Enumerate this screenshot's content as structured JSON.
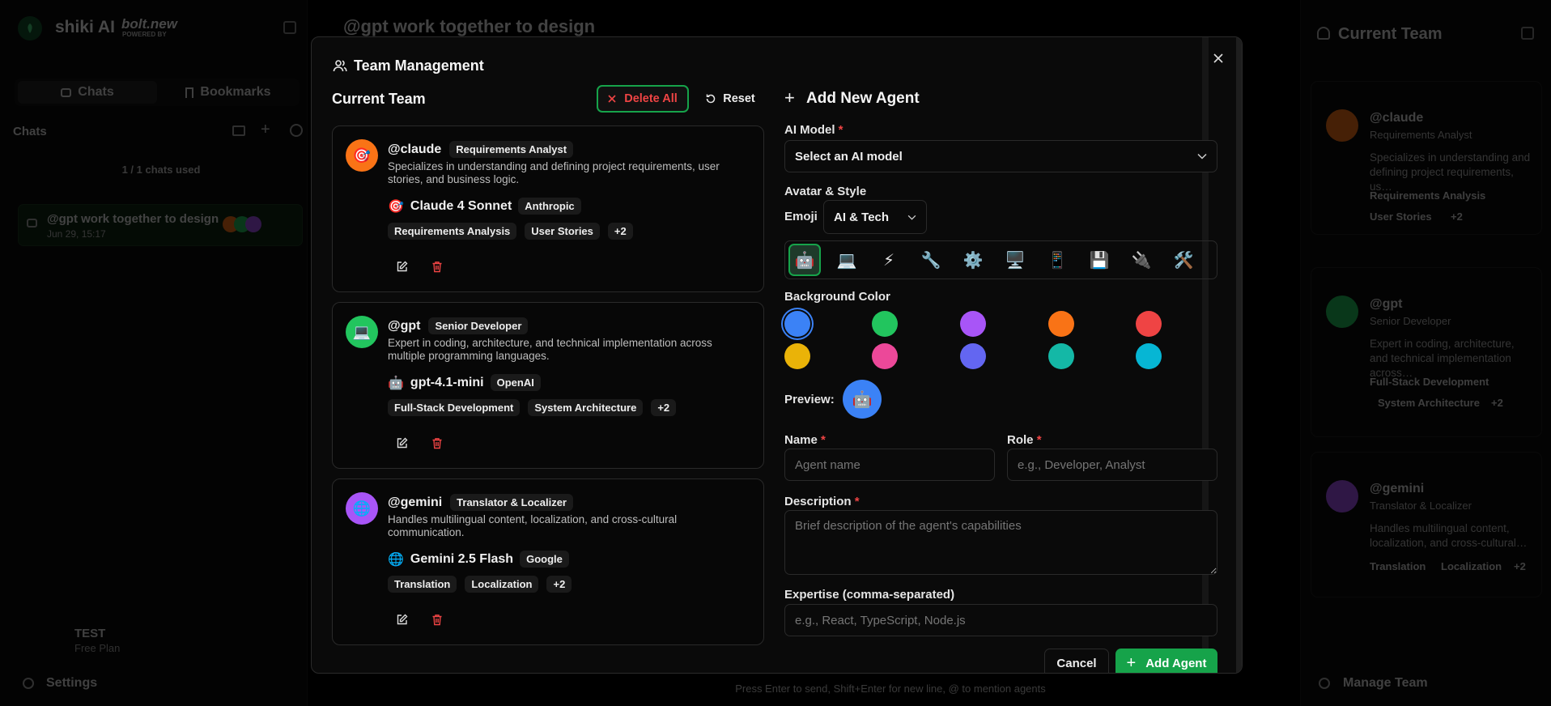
{
  "app": {
    "brand": "shiki AI",
    "bolt_logo": "bolt.new",
    "powered_by": "POWERED BY",
    "header_title": "@gpt work together to design",
    "tabs": {
      "chats": "Chats",
      "bookmarks": "Bookmarks"
    },
    "chats_heading": "Chats",
    "chats_used": "1 / 1 chats used",
    "chat_item": {
      "title": "@gpt work together to design",
      "date": "Jun 29, 15:17"
    },
    "user": {
      "name": "TEST",
      "plan": "Free Plan"
    },
    "settings_label": "Settings",
    "footer_hint": "Press Enter to send, Shift+Enter for new line, @ to mention agents",
    "right_panel": {
      "title": "Current Team",
      "manage_label": "Manage Team",
      "agents": [
        {
          "handle": "@claude",
          "role": "Requirements Analyst",
          "desc": "Specializes in understanding and defining project requirements, us…",
          "tags": [
            "Requirements Analysis",
            "User Stories"
          ],
          "more": "+2",
          "emoji": "🎯",
          "color": "#f97316"
        },
        {
          "handle": "@gpt",
          "role": "Senior Developer",
          "desc": "Expert in coding, architecture, and technical implementation across…",
          "tags": [
            "Full-Stack Development",
            "System Architecture"
          ],
          "more": "+2",
          "emoji": "⚡",
          "color": "#22c55e"
        },
        {
          "handle": "@gemini",
          "role": "Translator & Localizer",
          "desc": "Handles multilingual content, localization, and cross-cultural…",
          "tags": [
            "Translation",
            "Localization"
          ],
          "more": "+2",
          "emoji": "🌐",
          "color": "#a855f7"
        }
      ]
    }
  },
  "modal": {
    "title": "Team Management",
    "current_team_title": "Current Team",
    "delete_all_label": "Delete All",
    "reset_label": "Reset",
    "agents": [
      {
        "handle": "@claude",
        "role": "Requirements Analyst",
        "desc": "Specializes in understanding and defining project requirements, user stories, and business logic.",
        "emoji": "🎯",
        "color": "#f97316",
        "model_emoji": "🎯",
        "model": "Claude 4 Sonnet",
        "provider": "Anthropic",
        "tags": [
          "Requirements Analysis",
          "User Stories"
        ],
        "more": "+2"
      },
      {
        "handle": "@gpt",
        "role": "Senior Developer",
        "desc": "Expert in coding, architecture, and technical implementation across multiple programming languages.",
        "emoji": "💻",
        "color": "#22c55e",
        "model_emoji": "🤖",
        "model": "gpt-4.1-mini",
        "provider": "OpenAI",
        "tags": [
          "Full-Stack Development",
          "System Architecture"
        ],
        "more": "+2"
      },
      {
        "handle": "@gemini",
        "role": "Translator & Localizer",
        "desc": "Handles multilingual content, localization, and cross-cultural communication.",
        "emoji": "🌐",
        "color": "#a855f7",
        "model_emoji": "🌐",
        "model": "Gemini 2.5 Flash",
        "provider": "Google",
        "tags": [
          "Translation",
          "Localization"
        ],
        "more": "+2"
      }
    ],
    "form": {
      "title": "Add New Agent",
      "model_label": "AI Model",
      "model_placeholder": "Select an AI model",
      "avatar_label": "Avatar & Style",
      "emoji_label": "Emoji",
      "emoji_category": "AI & Tech",
      "emojis": [
        "🤖",
        "💻",
        "⚡",
        "🔧",
        "⚙️",
        "🖥️",
        "📱",
        "💾",
        "🔌",
        "🛠️"
      ],
      "bg_label": "Background Color",
      "colors": [
        "#3b82f6",
        "#22c55e",
        "#a855f7",
        "#f97316",
        "#ef4444",
        "#eab308",
        "#ec4899",
        "#6366f1",
        "#14b8a6",
        "#06b6d4"
      ],
      "preview_label": "Preview:",
      "preview_emoji": "🤖",
      "name_label": "Name",
      "name_placeholder": "Agent name",
      "role_label": "Role",
      "role_placeholder": "e.g., Developer, Analyst",
      "desc_label": "Description",
      "desc_placeholder": "Brief description of the agent's capabilities",
      "expertise_label": "Expertise (comma-separated)",
      "expertise_placeholder": "e.g., React, TypeScript, Node.js",
      "cancel_label": "Cancel",
      "add_label": "Add Agent"
    }
  }
}
